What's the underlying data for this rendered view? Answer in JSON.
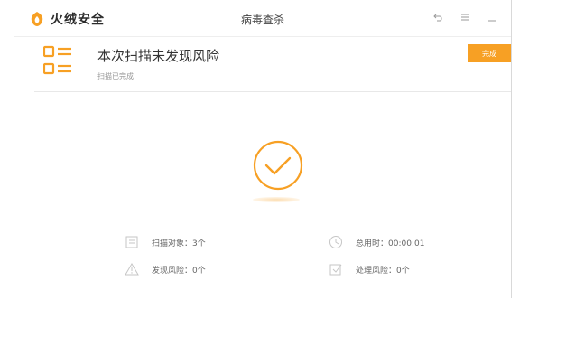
{
  "window": {
    "brand_name": "火绒安全",
    "title": "病毒查杀",
    "controls": [
      "back-icon",
      "menu-icon",
      "minimize-icon"
    ]
  },
  "result": {
    "title": "本次扫描未发现风险",
    "subtitle": "扫描已完成",
    "finish_label": "完成",
    "status_icon": "check-circle-icon"
  },
  "stats": {
    "scanned_objects": "扫描对象：3个",
    "total_time": "总用时：00:00:01",
    "found_risks": "发现风险：0个",
    "handled_risks": "处理风险：0个"
  },
  "colors": {
    "accent": "#f7a024",
    "muted": "#c6c6c6"
  }
}
